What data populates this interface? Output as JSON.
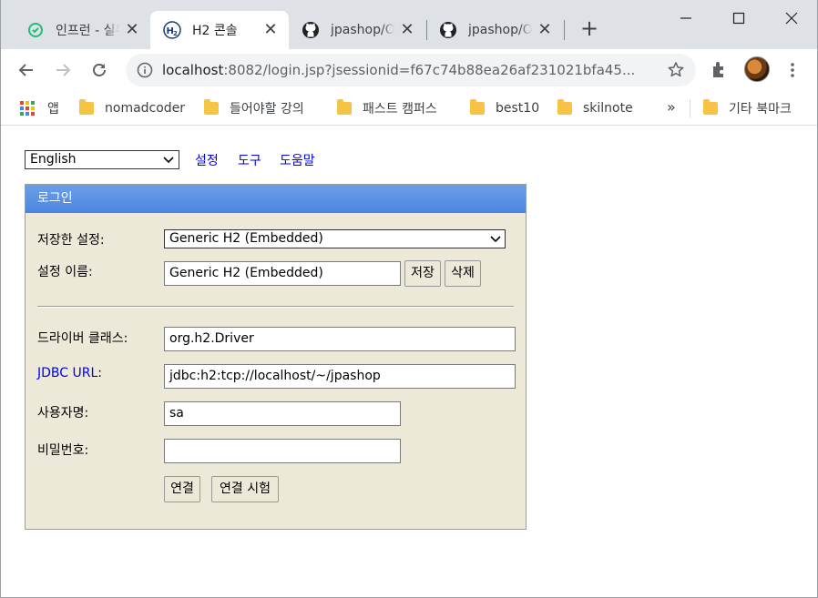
{
  "tabs": [
    {
      "label": "인프런 - 실무",
      "favicon": "inflearn-icon",
      "active": false
    },
    {
      "label": "H2 콘솔",
      "favicon": "h2-icon",
      "active": true
    },
    {
      "label": "jpashop/O",
      "favicon": "github-icon",
      "active": false
    },
    {
      "label": "jpashop/O",
      "favicon": "github-icon",
      "active": false
    }
  ],
  "address_bar": {
    "host": "localhost",
    "rest": ":8082/login.jsp?jsessionid=f67c74b88ea26af231021bfa45..."
  },
  "bookmarks": {
    "apps_label": "앱",
    "items": [
      "nomadcoder",
      "들어야할 강의",
      "패스트 캠퍼스",
      "best10",
      "skilnote"
    ],
    "more": "»",
    "other": "기타 북마크"
  },
  "page": {
    "language": "English",
    "links": [
      "설정",
      "도구",
      "도움말"
    ],
    "login": {
      "title": "로그인",
      "saved_settings_label": "저장한 설정:",
      "saved_settings_value": "Generic H2 (Embedded)",
      "setting_name_label": "설정 이름:",
      "setting_name_value": "Generic H2 (Embedded)",
      "save_button": "저장",
      "delete_button": "삭제",
      "driver_class_label": "드라이버 클래스:",
      "driver_class_value": "org.h2.Driver",
      "jdbc_url_label": "JDBC URL",
      "jdbc_url_colon": ":",
      "jdbc_url_value": "jdbc:h2:tcp://localhost/~/jpashop",
      "username_label": "사용자명:",
      "username_value": "sa",
      "password_label": "비밀번호:",
      "password_value": "",
      "connect_button": "연결",
      "test_connection_button": "연결 시험"
    }
  }
}
